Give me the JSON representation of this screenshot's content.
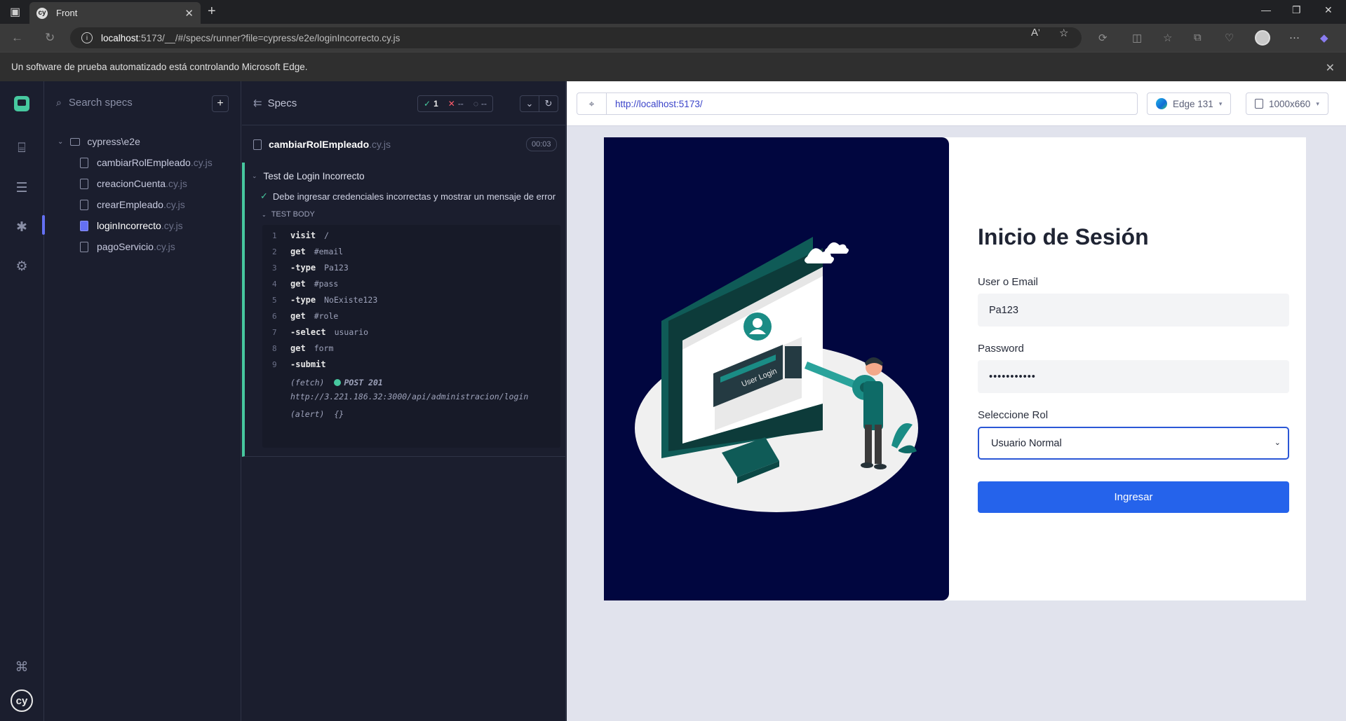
{
  "browser": {
    "tab_title": "Front",
    "favicon_letter": "cy",
    "url_host": "localhost",
    "url_path": ":5173/__/#/specs/runner?file=cypress/e2e/loginIncorrecto.cy.js",
    "infobar_text": "Un software de prueba automatizado está controlando Microsoft Edge."
  },
  "specs_panel": {
    "search_placeholder": "Search specs",
    "folder": "cypress\\e2e",
    "items": [
      {
        "name": "cambiarRolEmpleado",
        "ext": ".cy.js"
      },
      {
        "name": "creacionCuenta",
        "ext": ".cy.js"
      },
      {
        "name": "crearEmpleado",
        "ext": ".cy.js"
      },
      {
        "name": "loginIncorrecto",
        "ext": ".cy.js"
      },
      {
        "name": "pagoServicio",
        "ext": ".cy.js"
      }
    ],
    "active_index": 3
  },
  "reporter": {
    "header": "Specs",
    "passed": "1",
    "failed": "--",
    "pending": "--",
    "file_name": "cambiarRolEmpleado",
    "file_ext": ".cy.js",
    "duration": "00:03",
    "suite_title": "Test de Login Incorrecto",
    "test_title": "Debe ingresar credenciales incorrectas y mostrar un mensaje de error",
    "body_label": "TEST BODY",
    "commands": [
      {
        "num": "1",
        "name": "visit",
        "arg": "/"
      },
      {
        "num": "2",
        "name": "get",
        "arg": "#email"
      },
      {
        "num": "3",
        "name": "-type",
        "arg": "Pa123"
      },
      {
        "num": "4",
        "name": "get",
        "arg": "#pass"
      },
      {
        "num": "5",
        "name": "-type",
        "arg": "NoExiste123"
      },
      {
        "num": "6",
        "name": "get",
        "arg": "#role"
      },
      {
        "num": "7",
        "name": "-select",
        "arg": "usuario"
      },
      {
        "num": "8",
        "name": "get",
        "arg": "form"
      },
      {
        "num": "9",
        "name": "-submit",
        "arg": ""
      }
    ],
    "fetch_label": "(fetch)",
    "fetch_method": "POST 201",
    "fetch_url": "http://3.221.186.32:3000/api/administracion/login",
    "alert_label": "(alert)",
    "alert_value": "{}"
  },
  "aut": {
    "url": "http://localhost:5173/",
    "browser_label": "Edge 131",
    "viewport_label": "1000x660"
  },
  "login": {
    "title": "Inicio de Sesión",
    "user_label": "User o Email",
    "user_value": "Pa123",
    "password_label": "Password",
    "password_value": "•••••••••••",
    "role_label": "Seleccione Rol",
    "role_value": "Usuario Normal",
    "submit_label": "Ingresar",
    "illustration_text": "User Login"
  }
}
